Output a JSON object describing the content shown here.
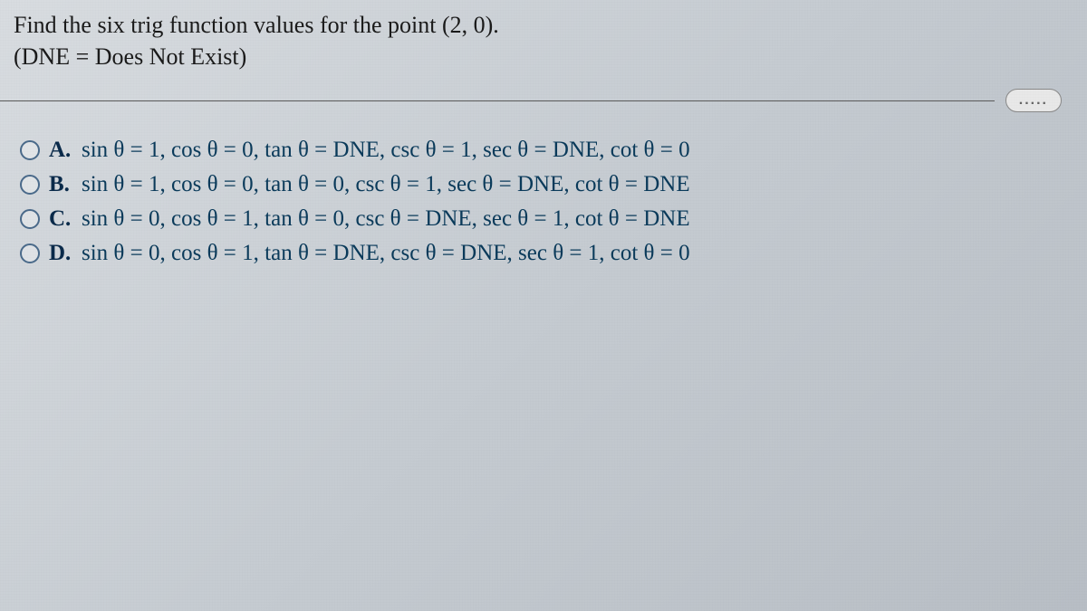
{
  "question": {
    "line1": "Find the six trig function values for the point (2, 0).",
    "line2": "(DNE = Does Not Exist)"
  },
  "more_button": ".....",
  "options": [
    {
      "letter": "A.",
      "text": "sin θ = 1,  cos θ = 0, tan θ = DNE,  csc θ = 1,  sec θ = DNE, cot θ = 0"
    },
    {
      "letter": "B.",
      "text": "sin θ = 1,  cos θ = 0, tan θ = 0,  csc θ = 1,  sec θ = DNE, cot θ = DNE"
    },
    {
      "letter": "C.",
      "text": "sin θ = 0,  cos θ = 1, tan θ = 0,  csc θ = DNE,  sec θ = 1, cot θ = DNE"
    },
    {
      "letter": "D.",
      "text": "sin θ = 0,  cos θ = 1, tan θ = DNE,  csc θ = DNE,  sec θ = 1, cot θ = 0"
    }
  ]
}
